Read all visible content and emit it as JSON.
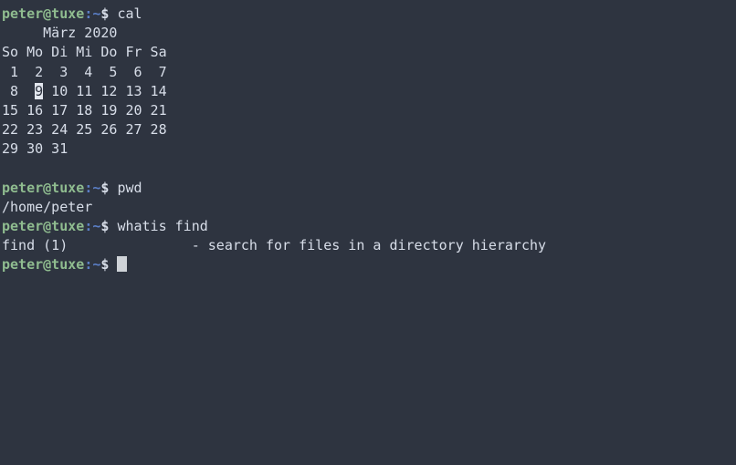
{
  "terminal": {
    "background_color": "#2e3440",
    "foreground_color": "#d8dee9",
    "prompt": {
      "user_host": "peter@tuxe",
      "colon": ":",
      "cwd": "~",
      "sigil": "$",
      "user_host_color": "#8fbc8f",
      "punct_color": "#5b7fc7",
      "sigil_color": "#d8dee9"
    },
    "cursor": {
      "color": "#cfd3d8",
      "shape": "block"
    },
    "lines": {
      "cmd_cal": "cal",
      "cal_title": "     März 2020",
      "cal_weekdays": "So Mo Di Mi Do Fr Sa",
      "cal_week1": " 1  2  3  4  5  6  7",
      "cal_week2_pre": " 8  ",
      "cal_week2_today": "9",
      "cal_week2_post": " 10 11 12 13 14",
      "cal_week3": "15 16 17 18 19 20 21",
      "cal_week4": "22 23 24 25 26 27 28",
      "cal_week5": "29 30 31",
      "blank": "",
      "cmd_pwd": "pwd",
      "out_pwd": "/home/peter",
      "cmd_whatis": "whatis find",
      "out_whatis": "find (1)               - search for files in a directory hierarchy"
    },
    "highlight": {
      "today": "9",
      "bg_color": "#e3e7ef",
      "fg_color": "#2e3440"
    }
  }
}
